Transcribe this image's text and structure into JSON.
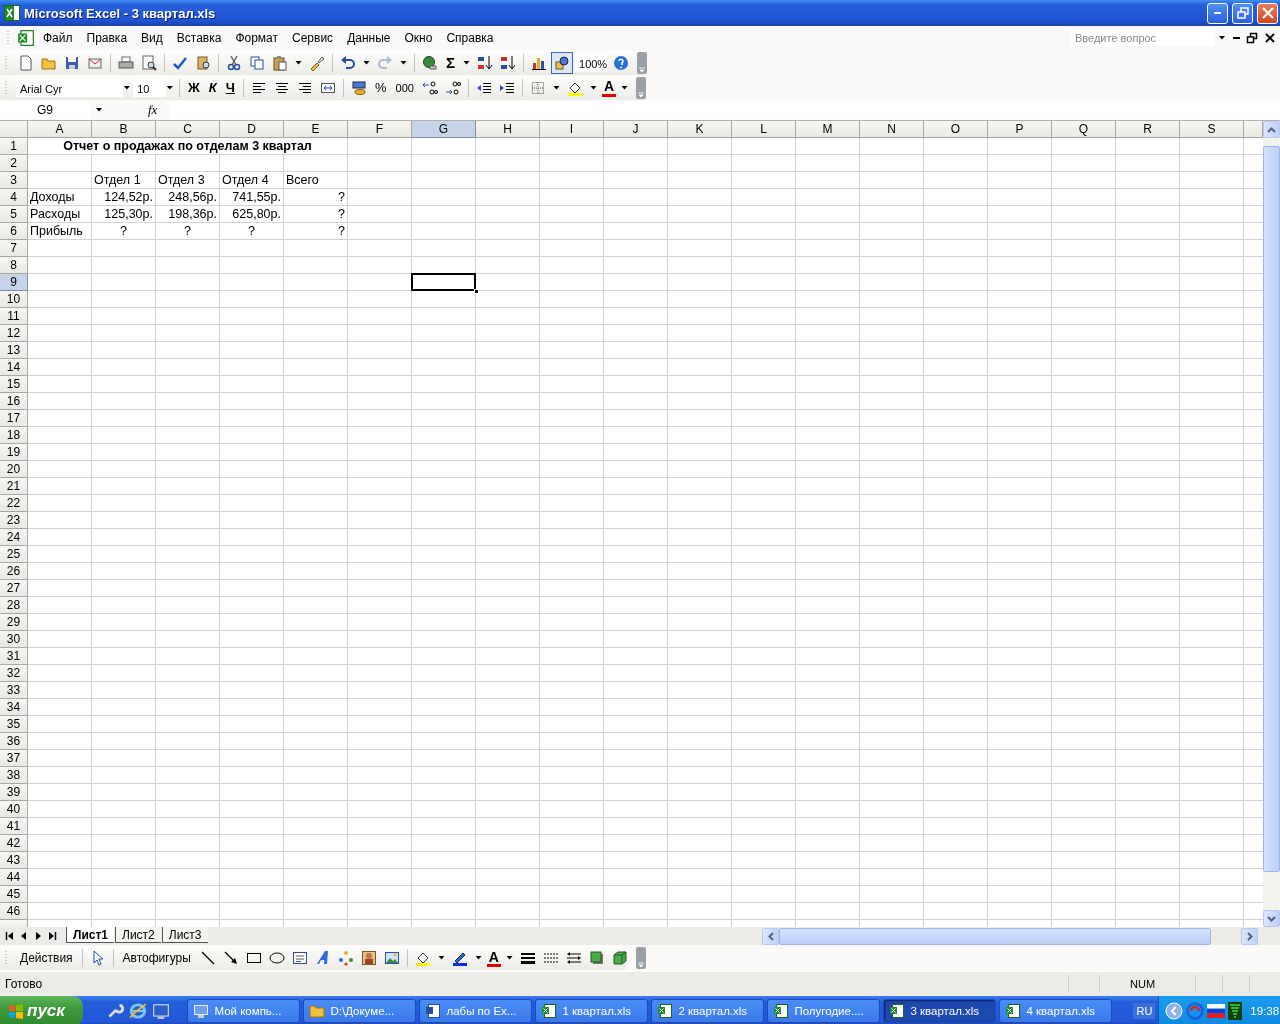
{
  "window": {
    "title": "Microsoft Excel - 3 квартал.xls"
  },
  "menu": {
    "items": [
      "Файл",
      "Правка",
      "Вид",
      "Вставка",
      "Формат",
      "Сервис",
      "Данные",
      "Окно",
      "Справка"
    ],
    "help_box": {
      "placeholder": "Введите вопрос"
    }
  },
  "standard_toolbar": {
    "sum_symbol": "Σ",
    "zoom": "100%",
    "redo_disabled": true,
    "drawing_pressed": true
  },
  "formatting_toolbar": {
    "font": "Arial Cyr",
    "size": "10",
    "bold_key": "Ж",
    "italic_key": "К",
    "underline_key": "Ч",
    "percent": "%",
    "thousands": "000",
    "font_color_glyph": "A"
  },
  "formula_bar": {
    "name_box": "G9",
    "fx": "fx"
  },
  "sheet": {
    "columns": [
      {
        "label": "A",
        "selected": false
      },
      {
        "label": "B",
        "selected": false
      },
      {
        "label": "C",
        "selected": false
      },
      {
        "label": "D",
        "selected": false
      },
      {
        "label": "E",
        "selected": false
      },
      {
        "label": "F",
        "selected": false
      },
      {
        "label": "G",
        "selected": true
      },
      {
        "label": "H",
        "selected": false
      },
      {
        "label": "I",
        "selected": false
      },
      {
        "label": "J",
        "selected": false
      },
      {
        "label": "K",
        "selected": false
      },
      {
        "label": "L",
        "selected": false
      },
      {
        "label": "M",
        "selected": false
      },
      {
        "label": "N",
        "selected": false
      },
      {
        "label": "O",
        "selected": false
      },
      {
        "label": "P",
        "selected": false
      },
      {
        "label": "Q",
        "selected": false
      },
      {
        "label": "R",
        "selected": false
      },
      {
        "label": "S",
        "selected": false
      }
    ],
    "title": "Отчет о продажах по отделам 3 квартал",
    "rows": [
      {
        "label": "1",
        "selected": false
      },
      {
        "label": "2",
        "selected": false
      },
      {
        "label": "3",
        "selected": false,
        "cells": {
          "B": {
            "text": "Отдел 1",
            "kind": "text"
          },
          "C": {
            "text": "Отдел 3",
            "kind": "text"
          },
          "D": {
            "text": "Отдел 4",
            "kind": "text"
          },
          "E": {
            "text": "Всего",
            "kind": "text"
          }
        }
      },
      {
        "label": "4",
        "selected": false,
        "cells": {
          "A": {
            "text": "Доходы",
            "kind": "text"
          },
          "B": {
            "text": "124,52р.",
            "kind": "number"
          },
          "C": {
            "text": "248,56р.",
            "kind": "number"
          },
          "D": {
            "text": "741,55р.",
            "kind": "number"
          },
          "E": {
            "text": "?",
            "kind": "number"
          }
        }
      },
      {
        "label": "5",
        "selected": false,
        "cells": {
          "A": {
            "text": "Расходы",
            "kind": "text"
          },
          "B": {
            "text": "125,30р.",
            "kind": "number"
          },
          "C": {
            "text": "198,36р.",
            "kind": "number"
          },
          "D": {
            "text": "625,80р.",
            "kind": "number"
          },
          "E": {
            "text": "?",
            "kind": "number"
          }
        }
      },
      {
        "label": "6",
        "selected": false,
        "cells": {
          "A": {
            "text": "Прибыль",
            "kind": "text"
          },
          "B": {
            "text": "?",
            "kind": "center"
          },
          "C": {
            "text": "?",
            "kind": "center"
          },
          "D": {
            "text": "?",
            "kind": "center"
          },
          "E": {
            "text": "?",
            "kind": "number"
          }
        }
      },
      {
        "label": "7",
        "selected": false
      },
      {
        "label": "8",
        "selected": false
      },
      {
        "label": "9",
        "selected": true
      },
      {
        "label": "10",
        "selected": false
      },
      {
        "label": "11",
        "selected": false
      },
      {
        "label": "12",
        "selected": false
      },
      {
        "label": "13",
        "selected": false
      },
      {
        "label": "14",
        "selected": false
      },
      {
        "label": "15",
        "selected": false
      },
      {
        "label": "16",
        "selected": false
      },
      {
        "label": "17",
        "selected": false
      },
      {
        "label": "18",
        "selected": false
      },
      {
        "label": "19",
        "selected": false
      },
      {
        "label": "20",
        "selected": false
      },
      {
        "label": "21",
        "selected": false
      },
      {
        "label": "22",
        "selected": false
      },
      {
        "label": "23",
        "selected": false
      },
      {
        "label": "24",
        "selected": false
      },
      {
        "label": "25",
        "selected": false
      },
      {
        "label": "26",
        "selected": false
      },
      {
        "label": "27",
        "selected": false
      },
      {
        "label": "28",
        "selected": false
      },
      {
        "label": "29",
        "selected": false
      },
      {
        "label": "30",
        "selected": false
      },
      {
        "label": "31",
        "selected": false
      },
      {
        "label": "32",
        "selected": false
      },
      {
        "label": "33",
        "selected": false
      },
      {
        "label": "34",
        "selected": false
      },
      {
        "label": "35",
        "selected": false
      },
      {
        "label": "36",
        "selected": false
      },
      {
        "label": "37",
        "selected": false
      },
      {
        "label": "38",
        "selected": false
      },
      {
        "label": "39",
        "selected": false
      },
      {
        "label": "40",
        "selected": false
      },
      {
        "label": "41",
        "selected": false
      },
      {
        "label": "42",
        "selected": false
      },
      {
        "label": "43",
        "selected": false
      },
      {
        "label": "44",
        "selected": false
      },
      {
        "label": "45",
        "selected": false
      },
      {
        "label": "46",
        "selected": false
      }
    ]
  },
  "sheet_tabs": [
    {
      "label": "Лист1",
      "selected": true
    },
    {
      "label": "Лист2",
      "selected": false
    },
    {
      "label": "Лист3",
      "selected": false
    }
  ],
  "drawing_toolbar": {
    "actions": "Действия",
    "autoshapes": "Автофигуры",
    "font_color_glyph": "A"
  },
  "status_bar": {
    "status": "Готово",
    "num": "NUM"
  },
  "taskbar": {
    "start": "пуск",
    "tasks": [
      {
        "label": "Мой компь...",
        "kind": "computer",
        "selected": false
      },
      {
        "label": "D:\\Докуме...",
        "kind": "folder",
        "selected": false
      },
      {
        "label": "лабы по Ex...",
        "kind": "word",
        "selected": false
      },
      {
        "label": "1 квартал.xls",
        "kind": "excel",
        "selected": false
      },
      {
        "label": "2 квартал.xls",
        "kind": "excel",
        "selected": false
      },
      {
        "label": "Полугодие....",
        "kind": "excel",
        "selected": false
      },
      {
        "label": "3 квартал.xls",
        "kind": "excel",
        "selected": true
      },
      {
        "label": "4 квартал.xls",
        "kind": "excel",
        "selected": false
      }
    ],
    "language": "RU",
    "clock": "19:38"
  }
}
